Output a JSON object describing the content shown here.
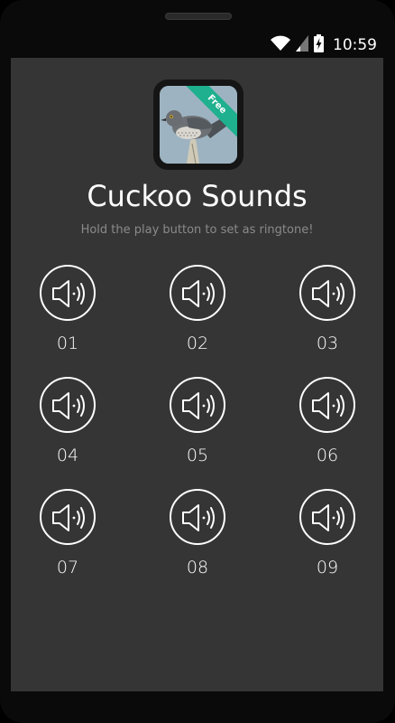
{
  "status_bar": {
    "time": "10:59",
    "icons": [
      "wifi-icon",
      "signal-icon",
      "battery-charging-icon"
    ]
  },
  "app": {
    "icon_badge": "Free",
    "title": "Cuckoo Sounds",
    "subtitle": "Hold the play button to set as ringtone!"
  },
  "sounds": [
    {
      "label": "01",
      "icon": "speaker-icon"
    },
    {
      "label": "02",
      "icon": "speaker-icon"
    },
    {
      "label": "03",
      "icon": "speaker-icon"
    },
    {
      "label": "04",
      "icon": "speaker-icon"
    },
    {
      "label": "05",
      "icon": "speaker-icon"
    },
    {
      "label": "06",
      "icon": "speaker-icon"
    },
    {
      "label": "07",
      "icon": "speaker-icon"
    },
    {
      "label": "08",
      "icon": "speaker-icon"
    },
    {
      "label": "09",
      "icon": "speaker-icon"
    }
  ],
  "colors": {
    "background": "#353535",
    "accent_ribbon": "#1fb08f",
    "text": "#ffffff",
    "subtitle": "#8a8a8a"
  }
}
